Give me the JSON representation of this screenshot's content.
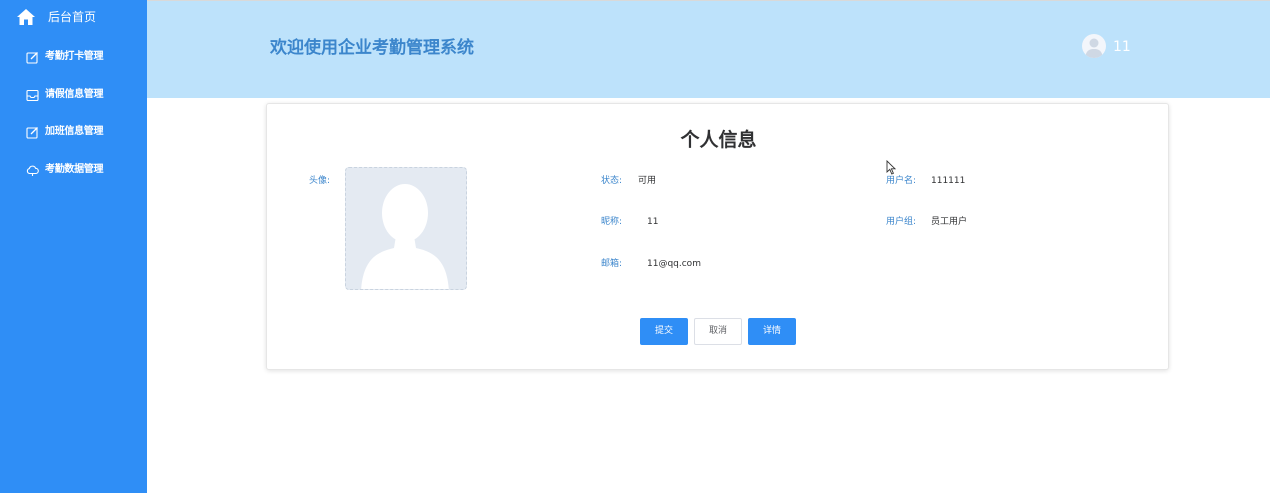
{
  "sidebar": {
    "home": {
      "label": "后台首页",
      "icon": "home-icon"
    },
    "items": [
      {
        "label": "考勤打卡管理",
        "icon": "edit-icon"
      },
      {
        "label": "请假信息管理",
        "icon": "inbox-icon"
      },
      {
        "label": "加班信息管理",
        "icon": "edit-icon"
      },
      {
        "label": "考勤数据管理",
        "icon": "cloud-icon"
      }
    ]
  },
  "header": {
    "title": "欢迎使用企业考勤管理系统",
    "username": "11",
    "avatar_icon": "user-avatar-icon"
  },
  "profile": {
    "title": "个人信息",
    "avatar_label": "头像:",
    "fields": {
      "status": {
        "label": "状态:",
        "value": "可用"
      },
      "username": {
        "label": "用户名:",
        "value": "111111"
      },
      "nickname": {
        "label": "昵称:",
        "value": "11"
      },
      "group": {
        "label": "用户组:",
        "value": "员工用户"
      },
      "email": {
        "label": "邮箱:",
        "value": "11@qq.com"
      }
    },
    "buttons": {
      "submit": "提交",
      "cancel": "取消",
      "details": "详情"
    }
  },
  "colors": {
    "sidebar_bg": "#2f8ef6",
    "header_bg": "#bde2fb",
    "title_text": "#3c86cc",
    "primary_button": "#2f8ef6"
  }
}
